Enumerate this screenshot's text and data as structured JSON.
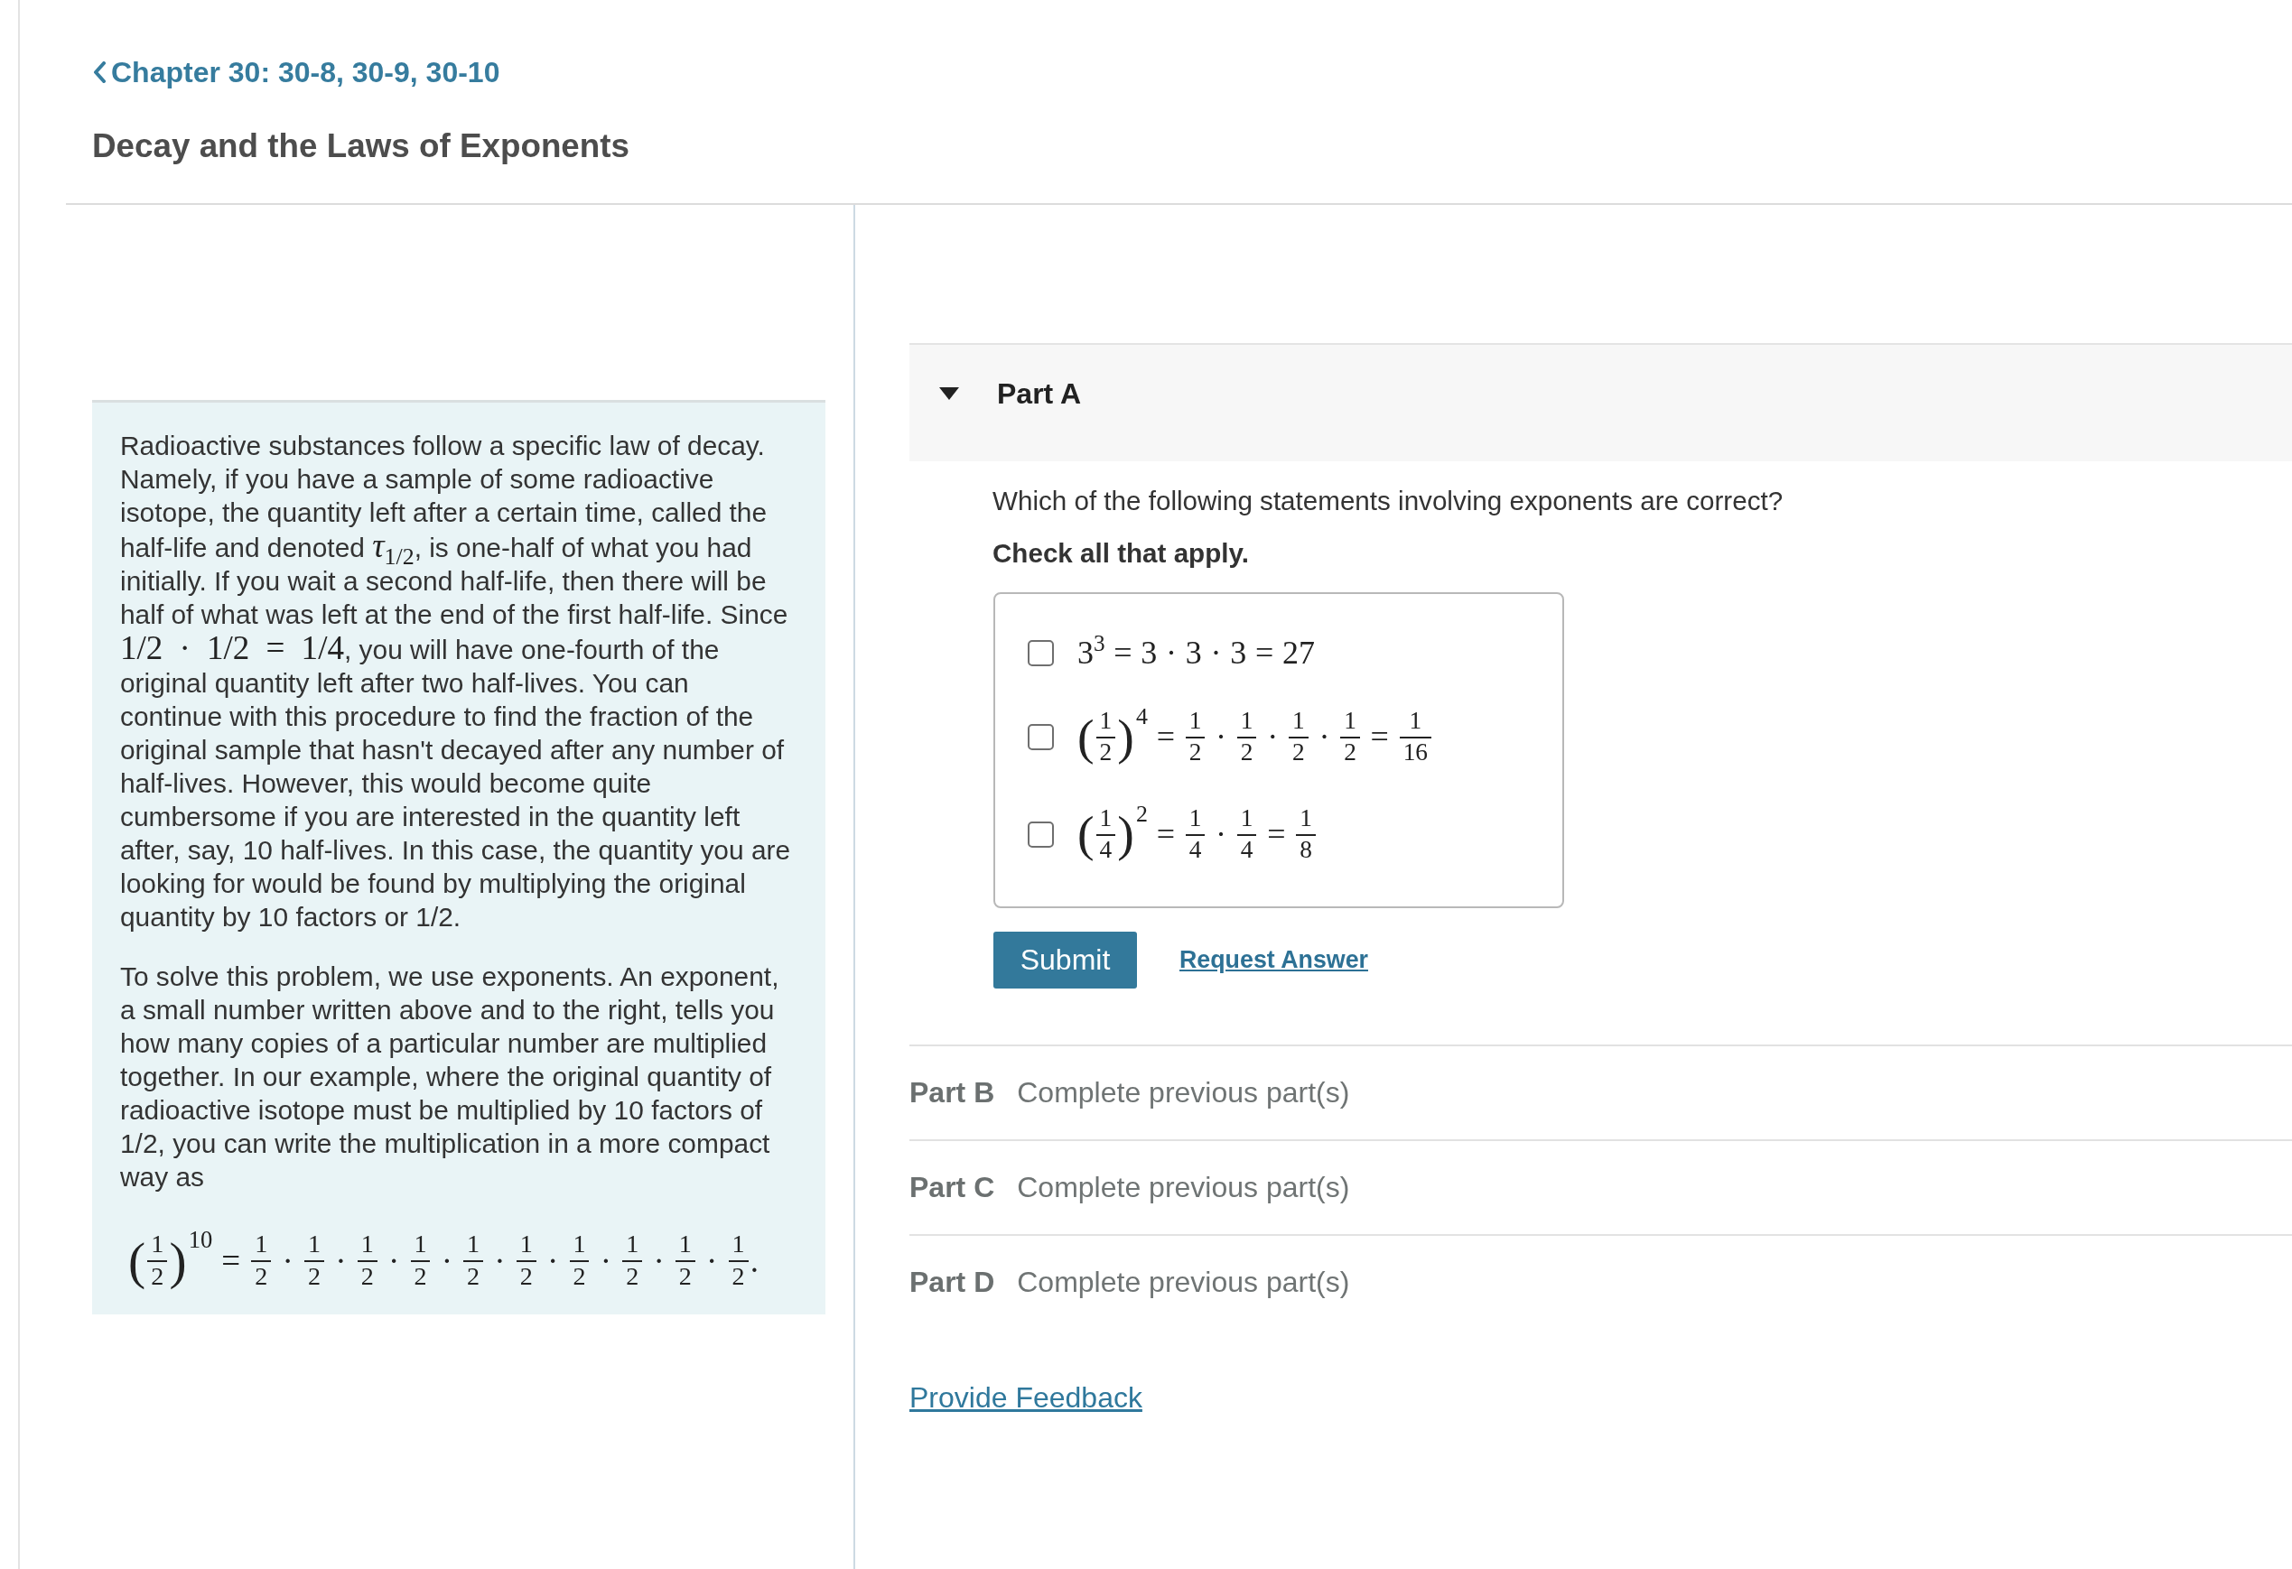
{
  "back_link": {
    "label": "Chapter 30: 30-8, 30-9, 30-10"
  },
  "title": "Decay and the Laws of Exponents",
  "intro": {
    "paragraphs": [
      [
        {
          "kind": "text",
          "text": "Radioactive substances follow a specific law of decay. Namely, if you have a sample of some radioactive isotope, the quantity left after a certain time, called the half-life and denoted "
        },
        {
          "kind": "math",
          "text": "*τ*$_{1/2}$"
        },
        {
          "kind": "text",
          "text": ", is one-half of what you had initially. If you wait a second half-life, then there will be half of what was left at the end of the first half-life. Since "
        },
        {
          "kind": "math",
          "text": "1/2 · 1/2 = 1/4"
        },
        {
          "kind": "text",
          "text": ", you will have one-fourth of the original quantity left after two half-lives. You can continue with this procedure to find the fraction of the original sample that hasn't decayed after any number of half-lives. However, this would become quite cumbersome if you are interested in the quantity left after, say, 10 half-lives. In this case, the quantity you are looking for would be found by multiplying the original quantity by 10 factors or 1/2."
        }
      ],
      [
        {
          "kind": "text",
          "text": "To solve this problem, we use exponents. An exponent, a small number written above and to the right, tells you how many copies of a particular number are multiplied together. In our example, where the original quantity of radioactive isotope must be multiplied by 10 factors of 1/2, you can write the multiplication in a more compact way as"
        }
      ]
    ],
    "formula": [
      {
        "kind": "paren",
        "text": "("
      },
      {
        "kind": "frac",
        "num": "1",
        "den": "2"
      },
      {
        "kind": "paren",
        "text": ")"
      },
      {
        "kind": "sup",
        "text": "10"
      },
      {
        "kind": "text",
        "text": " = "
      },
      {
        "kind": "frac",
        "num": "1",
        "den": "2"
      },
      {
        "kind": "text",
        "text": " · "
      },
      {
        "kind": "frac",
        "num": "1",
        "den": "2"
      },
      {
        "kind": "text",
        "text": " · "
      },
      {
        "kind": "frac",
        "num": "1",
        "den": "2"
      },
      {
        "kind": "text",
        "text": " · "
      },
      {
        "kind": "frac",
        "num": "1",
        "den": "2"
      },
      {
        "kind": "text",
        "text": " · "
      },
      {
        "kind": "frac",
        "num": "1",
        "den": "2"
      },
      {
        "kind": "text",
        "text": " · "
      },
      {
        "kind": "frac",
        "num": "1",
        "den": "2"
      },
      {
        "kind": "text",
        "text": " · "
      },
      {
        "kind": "frac",
        "num": "1",
        "den": "2"
      },
      {
        "kind": "text",
        "text": " · "
      },
      {
        "kind": "frac",
        "num": "1",
        "den": "2"
      },
      {
        "kind": "text",
        "text": " · "
      },
      {
        "kind": "frac",
        "num": "1",
        "den": "2"
      },
      {
        "kind": "text",
        "text": " · "
      },
      {
        "kind": "frac",
        "num": "1",
        "den": "2"
      },
      {
        "kind": "text",
        "text": "."
      }
    ]
  },
  "open_part": {
    "label": "Part A",
    "expanded": true,
    "question": "Which of the following statements involving exponents are correct?",
    "instruction": "Check all that apply.",
    "options": [
      {
        "checked": false,
        "formula": [
          {
            "kind": "text",
            "text": "3$^{3}$ = 3 · 3 · 3 = 27"
          }
        ]
      },
      {
        "checked": false,
        "formula": [
          {
            "kind": "paren",
            "text": "("
          },
          {
            "kind": "frac",
            "num": "1",
            "den": "2"
          },
          {
            "kind": "paren",
            "text": ")"
          },
          {
            "kind": "sup",
            "text": "4"
          },
          {
            "kind": "text",
            "text": " = "
          },
          {
            "kind": "frac",
            "num": "1",
            "den": "2"
          },
          {
            "kind": "text",
            "text": " · "
          },
          {
            "kind": "frac",
            "num": "1",
            "den": "2"
          },
          {
            "kind": "text",
            "text": " · "
          },
          {
            "kind": "frac",
            "num": "1",
            "den": "2"
          },
          {
            "kind": "text",
            "text": " · "
          },
          {
            "kind": "frac",
            "num": "1",
            "den": "2"
          },
          {
            "kind": "text",
            "text": " = "
          },
          {
            "kind": "frac",
            "num": "1",
            "den": "16"
          }
        ]
      },
      {
        "checked": false,
        "formula": [
          {
            "kind": "paren",
            "text": "("
          },
          {
            "kind": "frac",
            "num": "1",
            "den": "4"
          },
          {
            "kind": "paren",
            "text": ")"
          },
          {
            "kind": "sup",
            "text": "2"
          },
          {
            "kind": "text",
            "text": " = "
          },
          {
            "kind": "frac",
            "num": "1",
            "den": "4"
          },
          {
            "kind": "text",
            "text": " · "
          },
          {
            "kind": "frac",
            "num": "1",
            "den": "4"
          },
          {
            "kind": "text",
            "text": " = "
          },
          {
            "kind": "frac",
            "num": "1",
            "den": "8"
          }
        ]
      }
    ],
    "submit": "Submit",
    "request_answer": "Request Answer"
  },
  "locked_parts": [
    {
      "label": "Part B",
      "status": "Complete previous part(s)"
    },
    {
      "label": "Part C",
      "status": "Complete previous part(s)"
    },
    {
      "label": "Part D",
      "status": "Complete previous part(s)"
    }
  ],
  "feedback_link": "Provide Feedback"
}
